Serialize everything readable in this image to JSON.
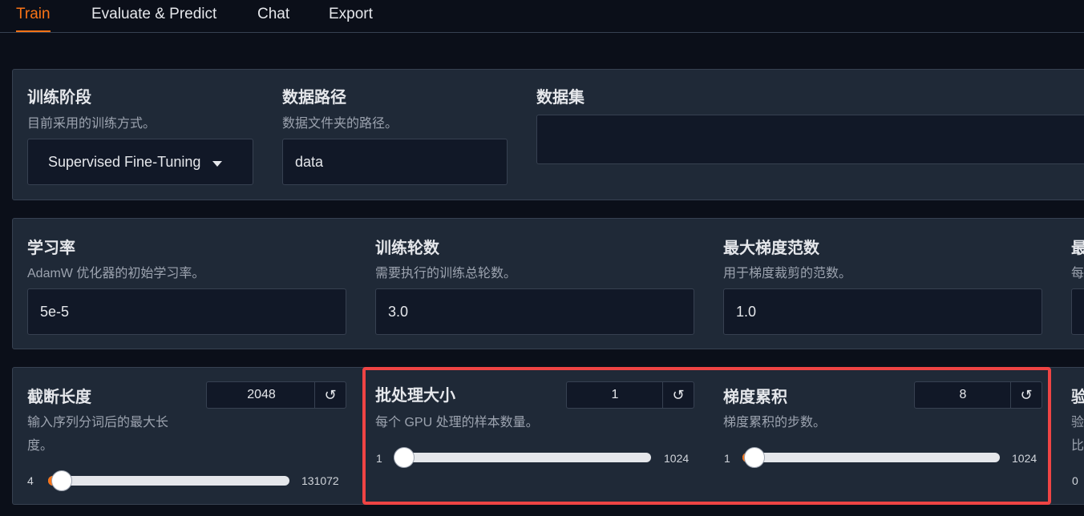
{
  "tabs": [
    {
      "label": "Train",
      "active": true
    },
    {
      "label": "Evaluate & Predict",
      "active": false
    },
    {
      "label": "Chat",
      "active": false
    },
    {
      "label": "Export",
      "active": false
    }
  ],
  "row1": {
    "stage": {
      "title": "训练阶段",
      "info": "目前采用的训练方式。",
      "value": "Supervised Fine-Tuning"
    },
    "data_path": {
      "title": "数据路径",
      "info": "数据文件夹的路径。",
      "value": "data"
    },
    "dataset": {
      "title": "数据集",
      "value": ""
    }
  },
  "row2": {
    "learning_rate": {
      "title": "学习率",
      "info": "AdamW 优化器的初始学习率。",
      "value": "5e-5"
    },
    "epochs": {
      "title": "训练轮数",
      "info": "需要执行的训练总轮数。",
      "value": "3.0"
    },
    "max_grad_norm": {
      "title": "最大梯度范数",
      "info": "用于梯度裁剪的范数。",
      "value": "1.0"
    },
    "cut_title": "最",
    "cut_info": "每"
  },
  "row3": {
    "cutoff_len": {
      "title": "截断长度",
      "info_line1": "输入序列分词后的最大长",
      "info_line2": "度。",
      "value": "2048",
      "min": "4",
      "max": "131072",
      "fraction": 0.0155
    },
    "batch_size": {
      "title": "批处理大小",
      "info": "每个 GPU 处理的样本数量。",
      "value": "1",
      "min": "1",
      "max": "1024",
      "fraction": 0.0
    },
    "grad_accum": {
      "title": "梯度累积",
      "info": "梯度累积的步数。",
      "value": "8",
      "min": "1",
      "max": "1024",
      "fraction": 0.007
    },
    "cut_title": "验",
    "cut_info1": "验",
    "cut_info2": "比",
    "cut_min": "0"
  },
  "reset_icon": "↺",
  "colors": {
    "accent": "#f97316",
    "highlight": "#ef4444",
    "panel": "#1f2937",
    "background": "#0b0f19"
  }
}
